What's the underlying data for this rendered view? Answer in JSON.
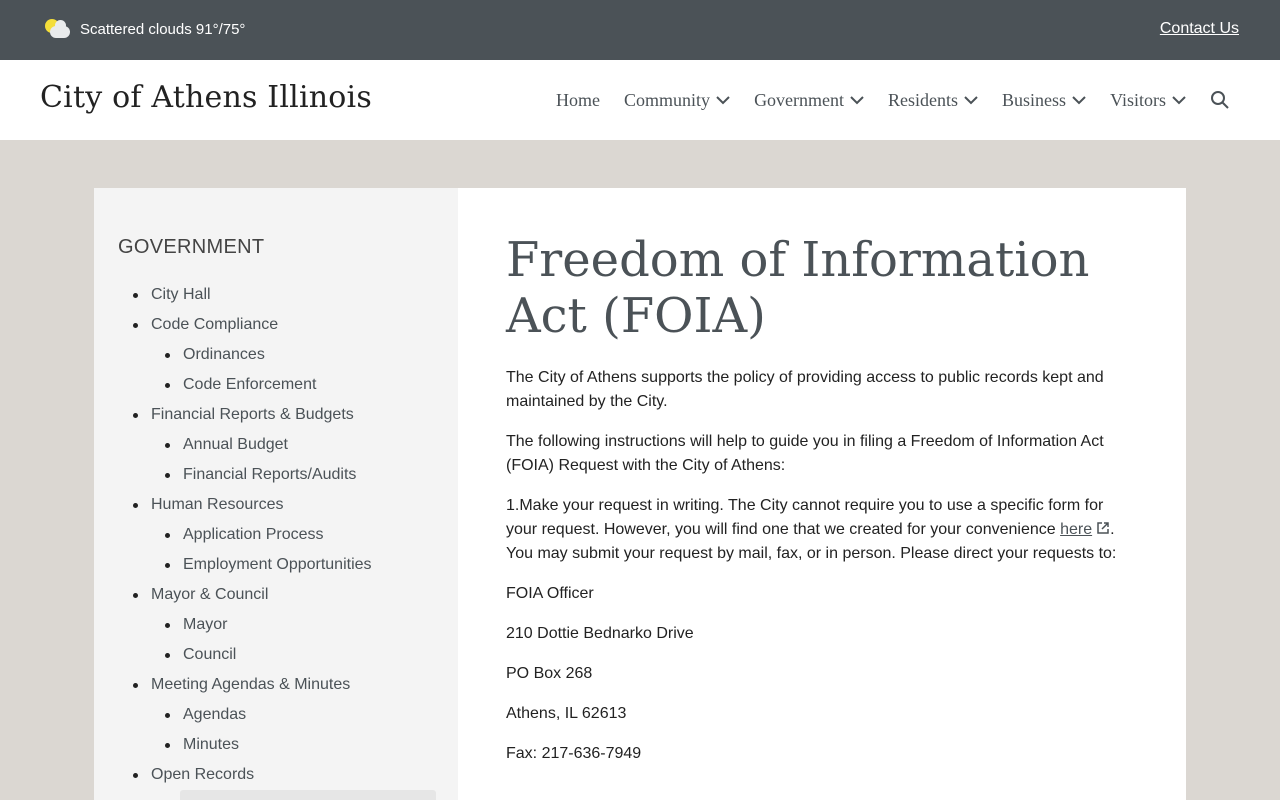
{
  "topbar": {
    "weather_text": "Scattered clouds 91°/75°",
    "contact_label": "Contact Us"
  },
  "header": {
    "site_title": "City of Athens Illinois",
    "nav": [
      {
        "label": "Home",
        "dropdown": false
      },
      {
        "label": "Community",
        "dropdown": true
      },
      {
        "label": "Government",
        "dropdown": true
      },
      {
        "label": "Residents",
        "dropdown": true
      },
      {
        "label": "Business",
        "dropdown": true
      },
      {
        "label": "Visitors",
        "dropdown": true
      }
    ],
    "search_icon": "search-icon"
  },
  "sidebar": {
    "heading": "GOVERNMENT",
    "items": [
      {
        "label": "City Hall",
        "level": 1
      },
      {
        "label": "Code Compliance",
        "level": 1
      },
      {
        "label": "Ordinances",
        "level": 2
      },
      {
        "label": "Code Enforcement",
        "level": 2
      },
      {
        "label": "Financial Reports & Budgets",
        "level": 1
      },
      {
        "label": "Annual Budget",
        "level": 2
      },
      {
        "label": "Financial Reports/Audits",
        "level": 2
      },
      {
        "label": "Human Resources",
        "level": 1
      },
      {
        "label": "Application Process",
        "level": 2
      },
      {
        "label": "Employment Opportunities",
        "level": 2
      },
      {
        "label": "Mayor & Council",
        "level": 1
      },
      {
        "label": "Mayor",
        "level": 2
      },
      {
        "label": "Council",
        "level": 2
      },
      {
        "label": "Meeting Agendas & Minutes",
        "level": 1
      },
      {
        "label": "Agendas",
        "level": 2
      },
      {
        "label": "Minutes",
        "level": 2
      },
      {
        "label": "Open Records",
        "level": 1
      }
    ]
  },
  "main": {
    "title": "Freedom of Information Act (FOIA)",
    "p1": "The City of Athens supports the policy of providing access to public records kept and maintained by the City.",
    "p2": "The following instructions will help to guide you in filing a Freedom of Information Act (FOIA) Request with the City of Athens:",
    "p3_before": "1.Make your request in writing. The City cannot require you to use a specific form for your request. However, you will find one that we created for your convenience ",
    "p3_link": "here",
    "p3_after": ". You may submit your request by mail, fax, or in person. Please direct your requests to:",
    "address": [
      "FOIA Officer",
      "210 Dottie Bednarko Drive",
      "PO Box 268",
      "Athens, IL 62613",
      "Fax: 217-636-7949"
    ]
  },
  "colors": {
    "topbar_bg": "#4b5257",
    "page_bg": "#dbd7d2",
    "sidebar_bg": "#f4f4f4",
    "accent_text": "#4b5257"
  }
}
